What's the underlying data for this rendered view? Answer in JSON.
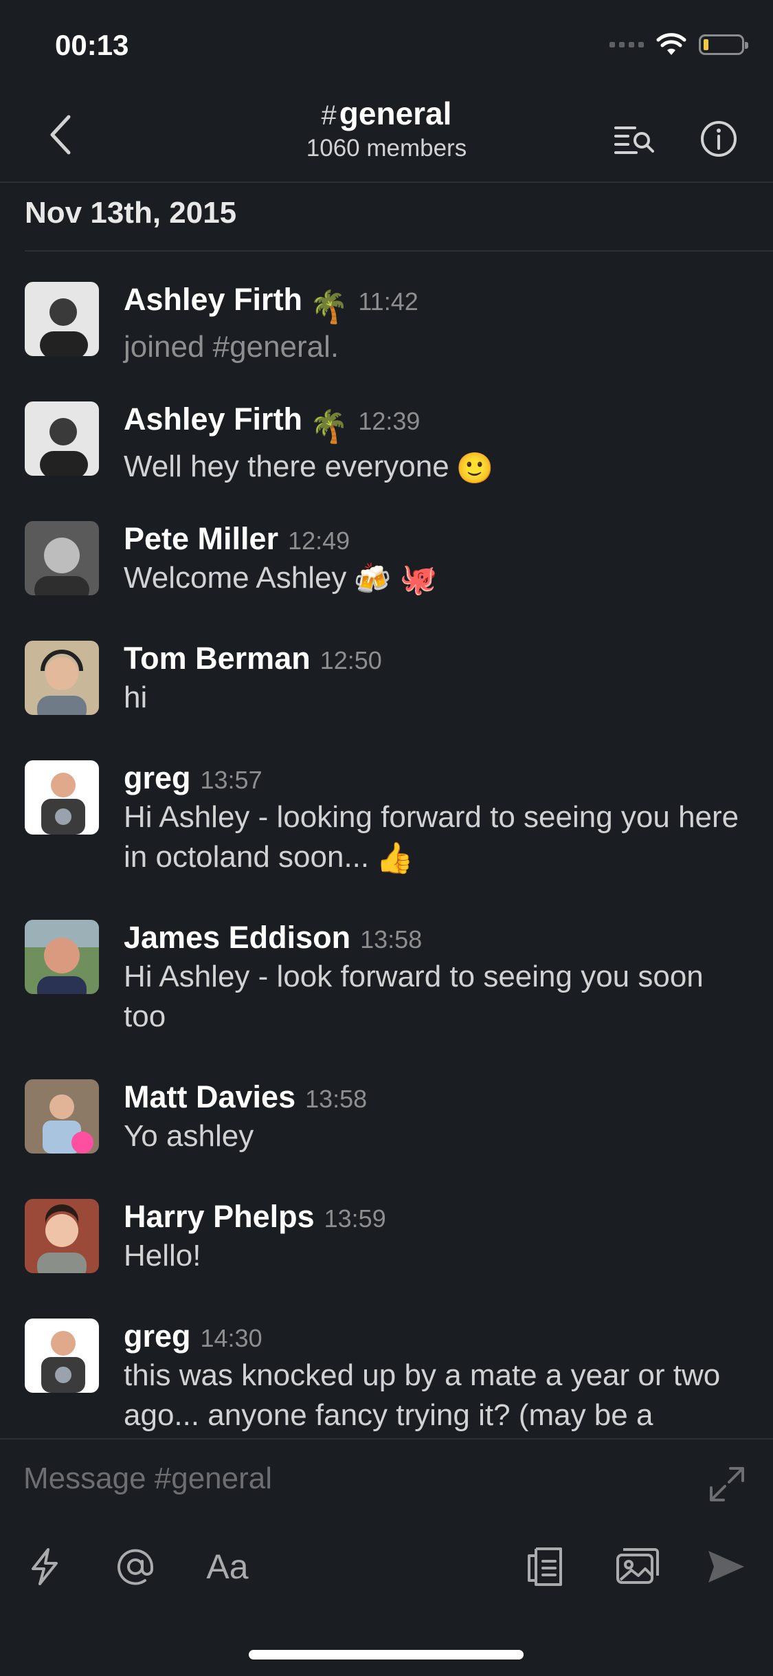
{
  "status_bar": {
    "time": "00:13",
    "battery_color": "#f2c744"
  },
  "header": {
    "channel_prefix": "#",
    "channel_name": "general",
    "members": "1060 members",
    "icons": [
      "back-chevron-icon",
      "search-messages-icon",
      "info-icon"
    ]
  },
  "date_header": "Nov 13th, 2015",
  "messages": [
    {
      "name": "Ashley Firth",
      "status_emoji": "🌴",
      "time": "11:42",
      "text": "joined #general.",
      "muted": true
    },
    {
      "name": "Ashley Firth",
      "status_emoji": "🌴",
      "time": "12:39",
      "text": "Well hey there everyone",
      "emoji": "🙂"
    },
    {
      "name": "Pete Miller",
      "time": "12:49",
      "text": "Welcome Ashley",
      "emoji": "🍻 🐙"
    },
    {
      "name": "Tom Berman",
      "time": "12:50",
      "text": "hi"
    },
    {
      "name": "greg",
      "time": "13:57",
      "text": "Hi Ashley - looking forward to seeing you here in octoland soon...",
      "emoji": "👍"
    },
    {
      "name": "James Eddison",
      "time": "13:58",
      "text": "Hi Ashley - look forward to seeing you soon too"
    },
    {
      "name": "Matt Davies",
      "time": "13:58",
      "text": "Yo ashley"
    },
    {
      "name": "Harry Phelps",
      "time": "13:59",
      "text": "Hello!"
    },
    {
      "name": "greg",
      "time": "14:30",
      "text": "this was knocked up by a mate a year or two ago... anyone fancy trying it? (may be a"
    }
  ],
  "composer": {
    "placeholder": "Message #general",
    "format_label": "Aa",
    "icons": [
      "lightning-icon",
      "at-mention-icon",
      "text-format-icon",
      "file-icon",
      "photo-icon",
      "send-icon",
      "expand-icon"
    ]
  }
}
